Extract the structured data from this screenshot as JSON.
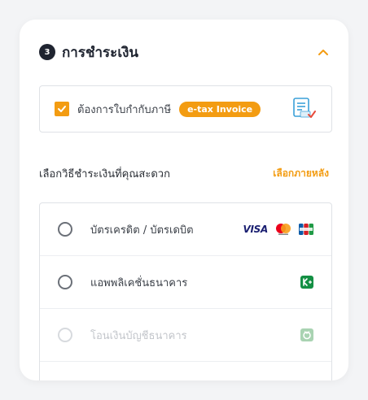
{
  "section": {
    "step": "3",
    "title": "การชำระเงิน",
    "chevron_icon": "chevron-up-icon"
  },
  "tax_invoice": {
    "checked": true,
    "label": "ต้องการใบกำกับภาษี",
    "badge": "e-tax Invoice",
    "icon": "etax-document-icon"
  },
  "payment_method": {
    "label": "เลือกวิธีชำระเงินที่คุณสะดวก",
    "later_link": "เลือกภายหลัง",
    "options": [
      {
        "label": "บัตรเครดิต / บัตรเดบิต",
        "icons": [
          "visa-logo",
          "mastercard-logo",
          "jcb-logo"
        ],
        "visa_text": "VISA",
        "disabled": false
      },
      {
        "label": "แอพพลิเคชั่นธนาคาร",
        "icons": [
          "kplus-icon"
        ],
        "disabled": false
      },
      {
        "label": "โอนเงินบัญชีธนาคาร",
        "icons": [
          "bank-transfer-icon"
        ],
        "disabled": true
      }
    ]
  },
  "colors": {
    "accent": "#f39c12",
    "dark": "#1f2430",
    "border": "#dfe2e6"
  }
}
